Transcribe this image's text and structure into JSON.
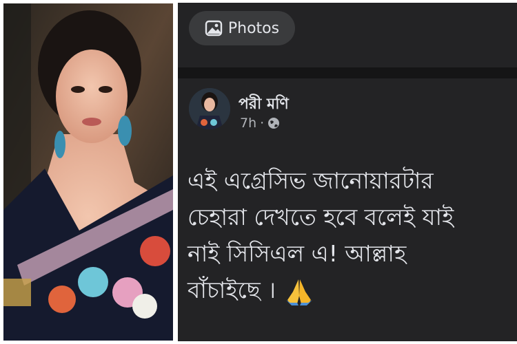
{
  "photos_chip": {
    "label": "Photos",
    "icon": "photos-icon"
  },
  "post": {
    "author": "পরী মণি",
    "time": "7h",
    "separator": "·",
    "privacy_icon": "globe-icon",
    "text": "এই এগ্রেসিভ জানোয়ারটার\nচেহারা দেখতে হবে বলেই যাই\nনাই সিসিএল এ! আল্লাহ\nবাঁচাইছে । ",
    "emoji": "folded-hands-emoji"
  },
  "colors": {
    "panel_bg": "#232325",
    "chip_bg": "#3a3b3d",
    "text_primary": "#e4e6eb",
    "text_secondary": "#b0b3b8",
    "divider": "#151516"
  }
}
